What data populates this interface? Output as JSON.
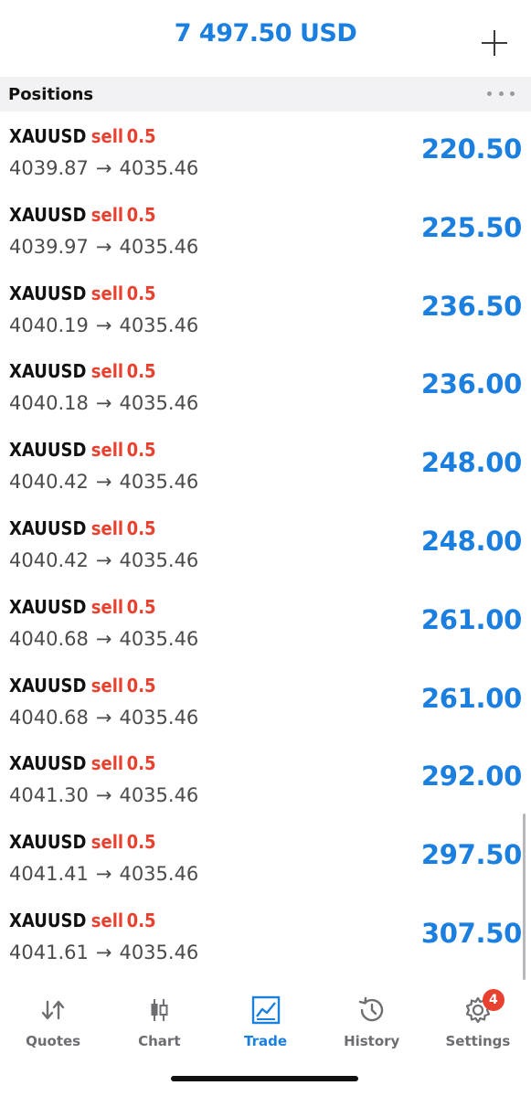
{
  "header": {
    "balance": "7 497.50 USD",
    "add_icon": "plus-icon"
  },
  "section": {
    "title": "Positions",
    "more_icon": "more-dots-icon"
  },
  "positions": [
    {
      "symbol": "XAUUSD",
      "side": "sell",
      "volume": "0.5",
      "open": "4039.87",
      "arrow": "→",
      "current": "4035.46",
      "profit": "220.50"
    },
    {
      "symbol": "XAUUSD",
      "side": "sell",
      "volume": "0.5",
      "open": "4039.97",
      "arrow": "→",
      "current": "4035.46",
      "profit": "225.50"
    },
    {
      "symbol": "XAUUSD",
      "side": "sell",
      "volume": "0.5",
      "open": "4040.19",
      "arrow": "→",
      "current": "4035.46",
      "profit": "236.50"
    },
    {
      "symbol": "XAUUSD",
      "side": "sell",
      "volume": "0.5",
      "open": "4040.18",
      "arrow": "→",
      "current": "4035.46",
      "profit": "236.00"
    },
    {
      "symbol": "XAUUSD",
      "side": "sell",
      "volume": "0.5",
      "open": "4040.42",
      "arrow": "→",
      "current": "4035.46",
      "profit": "248.00"
    },
    {
      "symbol": "XAUUSD",
      "side": "sell",
      "volume": "0.5",
      "open": "4040.42",
      "arrow": "→",
      "current": "4035.46",
      "profit": "248.00"
    },
    {
      "symbol": "XAUUSD",
      "side": "sell",
      "volume": "0.5",
      "open": "4040.68",
      "arrow": "→",
      "current": "4035.46",
      "profit": "261.00"
    },
    {
      "symbol": "XAUUSD",
      "side": "sell",
      "volume": "0.5",
      "open": "4040.68",
      "arrow": "→",
      "current": "4035.46",
      "profit": "261.00"
    },
    {
      "symbol": "XAUUSD",
      "side": "sell",
      "volume": "0.5",
      "open": "4041.30",
      "arrow": "→",
      "current": "4035.46",
      "profit": "292.00"
    },
    {
      "symbol": "XAUUSD",
      "side": "sell",
      "volume": "0.5",
      "open": "4041.41",
      "arrow": "→",
      "current": "4035.46",
      "profit": "297.50"
    },
    {
      "symbol": "XAUUSD",
      "side": "sell",
      "volume": "0.5",
      "open": "4041.61",
      "arrow": "→",
      "current": "4035.46",
      "profit": "307.50"
    }
  ],
  "tabs": [
    {
      "label": "Quotes",
      "icon": "quotes-arrows-icon",
      "active": false
    },
    {
      "label": "Chart",
      "icon": "candlestick-icon",
      "active": false
    },
    {
      "label": "Trade",
      "icon": "trade-chart-icon",
      "active": true
    },
    {
      "label": "History",
      "icon": "history-clock-icon",
      "active": false
    },
    {
      "label": "Settings",
      "icon": "gear-icon",
      "active": false,
      "badge": "4"
    }
  ],
  "colors": {
    "accent": "#1b7fe0",
    "sell": "#e8412f",
    "section_bg": "#f2f2f4",
    "muted": "#6d6d72"
  }
}
